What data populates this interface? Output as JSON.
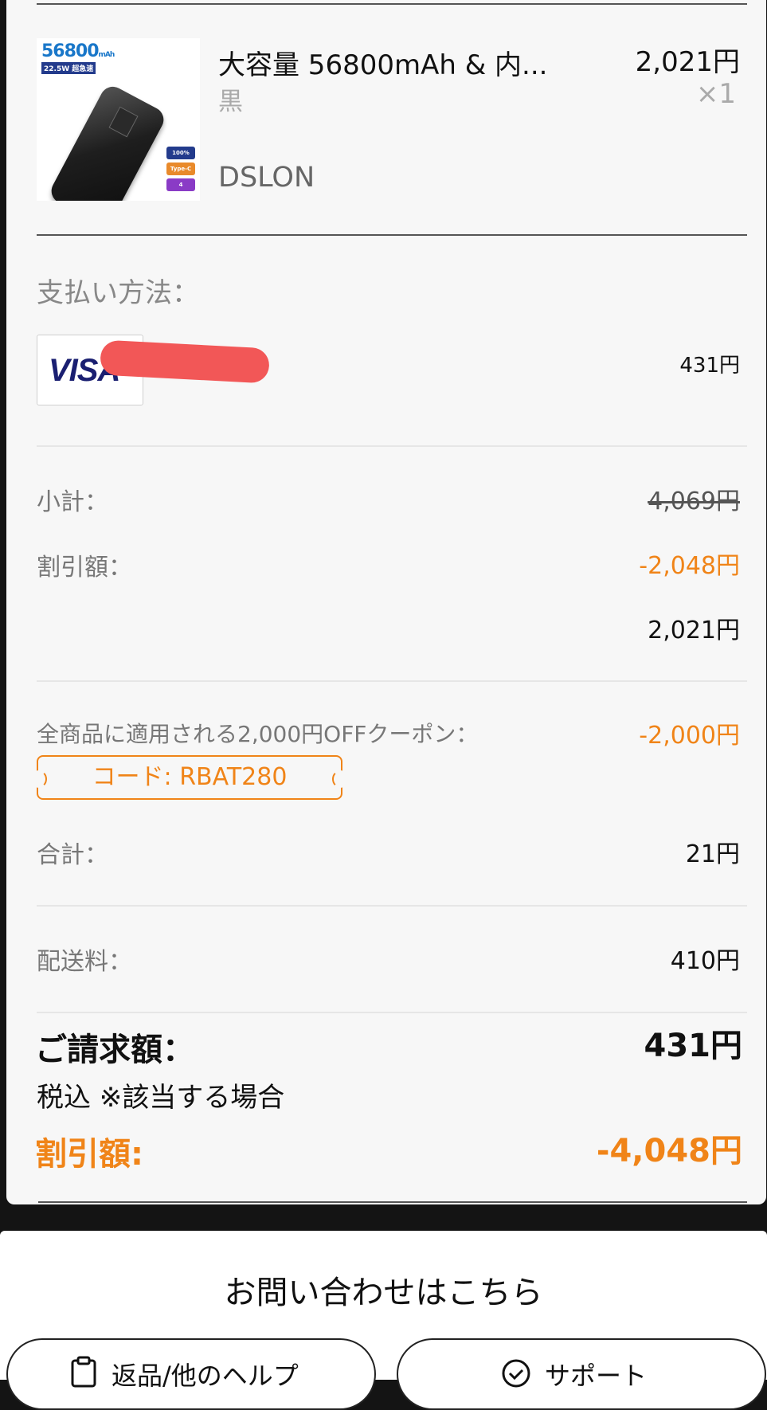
{
  "product": {
    "image_caption": "56800",
    "image_unit": "mAh",
    "image_tag": "22.5W 超急速",
    "image_badges": [
      "100%",
      "Type-C",
      "4"
    ],
    "title": "大容量 56800mAh & 内...",
    "color": "黒",
    "brand": "DSLON",
    "price": "2,021円",
    "qty": "×1"
  },
  "payment": {
    "label": "支払い方法：",
    "card_brand": "VISA",
    "amount": "431円"
  },
  "summary": {
    "subtotal_label": "小計：",
    "subtotal_value": "4,069円",
    "discount_label": "割引額：",
    "discount_value": "-2,048円",
    "after_discount_value": "2,021円"
  },
  "coupon": {
    "label": "全商品に適用される2,000円OFFクーポン：",
    "value": "-2,000円",
    "code": "コード: RBAT280"
  },
  "total": {
    "label": "合計：",
    "value": "21円"
  },
  "shipping": {
    "label": "配送料：",
    "value": "410円"
  },
  "billing": {
    "label": "ご請求額：",
    "value": "431円",
    "tax_note": "税込 ※該当する場合",
    "discount_label": "割引額:",
    "discount_value": "-4,048円"
  },
  "footer": {
    "title": "お問い合わせはこちら",
    "return_button": "返品/他のヘルプ",
    "support_button": "サポート"
  },
  "colors": {
    "accent": "#f08418",
    "visa": "#1a1f71",
    "redaction": "#f25757"
  }
}
